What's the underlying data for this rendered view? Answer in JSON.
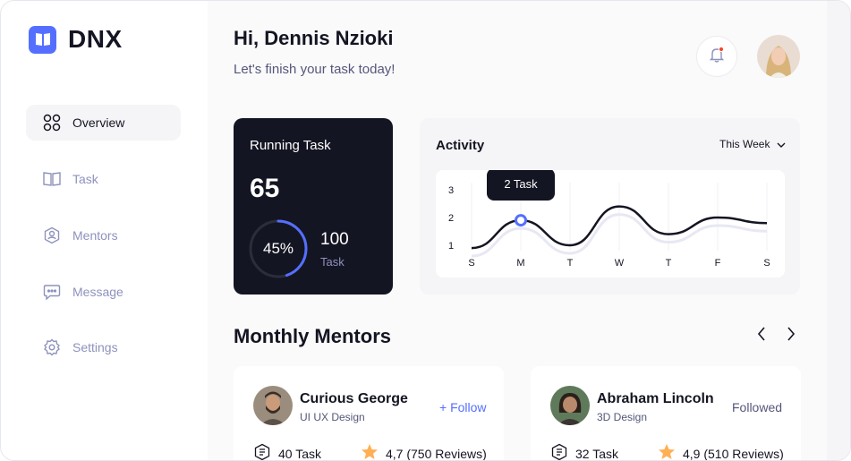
{
  "brand": {
    "name": "DNX"
  },
  "sidebar": {
    "items": [
      {
        "label": "Overview",
        "icon": "overview-icon",
        "active": true
      },
      {
        "label": "Task",
        "icon": "book-icon"
      },
      {
        "label": "Mentors",
        "icon": "mentors-icon"
      },
      {
        "label": "Message",
        "icon": "message-icon"
      },
      {
        "label": "Settings",
        "icon": "settings-icon"
      }
    ]
  },
  "header": {
    "greeting": "Hi, Dennis Nzioki",
    "subtitle": "Let's finish your task today!"
  },
  "running_task": {
    "label": "Running Task",
    "count": "65",
    "percent": "45%",
    "percent_value": 0.45,
    "total": "100",
    "total_label": "Task"
  },
  "activity": {
    "title": "Activity",
    "period": "This Week",
    "tooltip": "2 Task"
  },
  "chart_data": {
    "type": "line",
    "categories": [
      "S",
      "M",
      "T",
      "W",
      "T",
      "F",
      "S"
    ],
    "series": [
      {
        "values": [
          0.9,
          1.9,
          1.0,
          2.4,
          1.4,
          2.0,
          1.8
        ]
      }
    ],
    "ylim": [
      1,
      3
    ],
    "yticks": [
      "1",
      "2",
      "3"
    ],
    "highlight_index": 1,
    "grid": true
  },
  "mentors": {
    "title": "Monthly Mentors",
    "cards": [
      {
        "name": "Curious George",
        "role": "UI UX Design",
        "follow": "+ Follow",
        "followed": false,
        "tasks": "40 Task",
        "rating": "4,7 (750 Reviews)"
      },
      {
        "name": "Abraham Lincoln",
        "role": "3D Design",
        "follow": "Followed",
        "followed": true,
        "tasks": "32 Task",
        "rating": "4,9 (510 Reviews)"
      }
    ]
  },
  "colors": {
    "accent": "#546fff",
    "dark": "#141522",
    "muted": "#8e92bc",
    "star": "#ffb054"
  }
}
